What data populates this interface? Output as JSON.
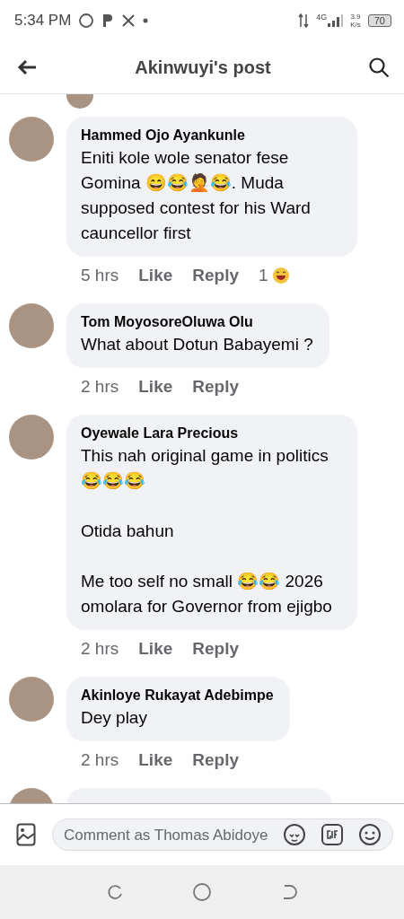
{
  "status_bar": {
    "time": "5:34 PM",
    "network": "4G",
    "speed": "3.9",
    "speed_unit": "K/s",
    "battery": "70"
  },
  "header": {
    "title": "Akinwuyi's post"
  },
  "comments": [
    {
      "name": "Hammed Ojo Ayankunle",
      "text": "Eniti kole wole senator fese Gomina 😄😂🤦😂. Muda supposed contest for his Ward cauncellor first",
      "time": "5 hrs",
      "like": "Like",
      "reply": "Reply",
      "reaction_count": "1"
    },
    {
      "name": "Tom MoyosoreOluwa Olu",
      "text": "What about Dotun Babayemi ?",
      "time": "2 hrs",
      "like": "Like",
      "reply": "Reply"
    },
    {
      "name": "Oyewale Lara Precious",
      "text": "This nah original game in politics 😂😂😂\n\nOtida bahun\n\nMe too self no small 😂😂 2026 omolara for Governor from ejigbo",
      "time": "2 hrs",
      "like": "Like",
      "reply": "Reply"
    },
    {
      "name": "Akinloye Rukayat Adebimpe",
      "text": "Dey play",
      "time": "2 hrs",
      "like": "Like",
      "reply": "Reply"
    }
  ],
  "composer": {
    "placeholder": "Comment as Thomas Abidoye"
  }
}
